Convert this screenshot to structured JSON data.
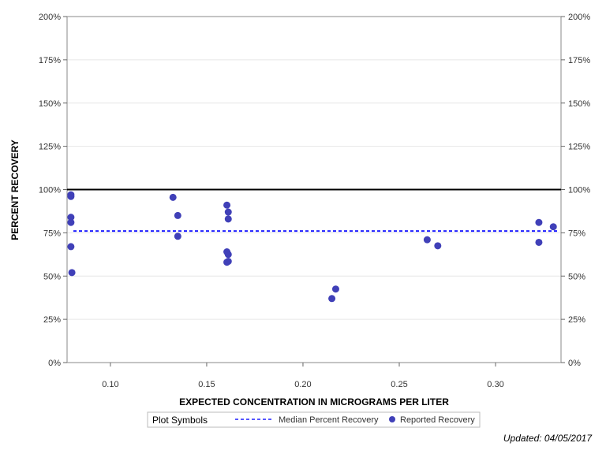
{
  "chart_data": {
    "type": "scatter",
    "xlabel": "EXPECTED CONCENTRATION IN MICROGRAMS PER LITER",
    "ylabel": "PERCENT RECOVERY",
    "xlim": [
      0.0775,
      0.334
    ],
    "ylim": [
      0,
      200
    ],
    "x_ticks": [
      0.1,
      0.15,
      0.2,
      0.25,
      0.3
    ],
    "x_tick_labels": [
      "0.10",
      "0.15",
      "0.20",
      "0.25",
      "0.30"
    ],
    "y_ticks": [
      0,
      25,
      50,
      75,
      100,
      125,
      150,
      175,
      200
    ],
    "y_tick_labels": [
      "0%",
      "25%",
      "50%",
      "75%",
      "100%",
      "125%",
      "150%",
      "175%",
      "200%"
    ],
    "grid": true,
    "reference_line": {
      "y": 100,
      "color": "#000000"
    },
    "median_line": {
      "y": 76,
      "color": "#1f1fff",
      "style": "dashed"
    },
    "series": [
      {
        "name": "Reported Recovery",
        "color": "#4040b8",
        "points": [
          {
            "x": 0.0795,
            "y": 97
          },
          {
            "x": 0.0795,
            "y": 96
          },
          {
            "x": 0.0795,
            "y": 84
          },
          {
            "x": 0.0795,
            "y": 81
          },
          {
            "x": 0.0795,
            "y": 67
          },
          {
            "x": 0.08,
            "y": 52
          },
          {
            "x": 0.1325,
            "y": 95.5
          },
          {
            "x": 0.135,
            "y": 85
          },
          {
            "x": 0.135,
            "y": 73
          },
          {
            "x": 0.1605,
            "y": 91
          },
          {
            "x": 0.1612,
            "y": 87
          },
          {
            "x": 0.1612,
            "y": 83
          },
          {
            "x": 0.1605,
            "y": 64
          },
          {
            "x": 0.1612,
            "y": 62.5
          },
          {
            "x": 0.1605,
            "y": 58
          },
          {
            "x": 0.1612,
            "y": 58.5
          },
          {
            "x": 0.215,
            "y": 37
          },
          {
            "x": 0.217,
            "y": 42.5
          },
          {
            "x": 0.2645,
            "y": 71
          },
          {
            "x": 0.27,
            "y": 67.5
          },
          {
            "x": 0.3225,
            "y": 81
          },
          {
            "x": 0.3225,
            "y": 69.5
          },
          {
            "x": 0.33,
            "y": 78.5
          }
        ]
      }
    ],
    "legend": {
      "title": "Plot Symbols",
      "placement": "bottom",
      "entries": [
        {
          "label": "Median Percent Recovery",
          "symbol": "dashed-line",
          "color": "#1f1fff"
        },
        {
          "label": "Reported Recovery",
          "symbol": "dot",
          "color": "#4040b8"
        }
      ]
    }
  },
  "footnote": "Updated: 04/05/2017"
}
